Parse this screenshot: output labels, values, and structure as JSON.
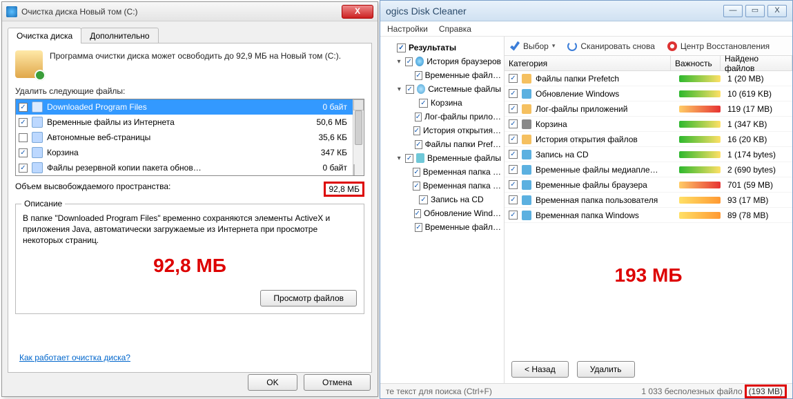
{
  "left": {
    "title": "Очистка диска Новый том (C:)",
    "close": "X",
    "tabs": {
      "active": "Очистка диска",
      "other": "Дополнительно"
    },
    "intro": "Программа очистки диска может освободить до 92,9 МБ на Новый том (C:).",
    "delete_label": "Удалить следующие файлы:",
    "items": [
      {
        "checked": true,
        "name": "Downloaded Program Files",
        "size": "0 байт",
        "sel": true
      },
      {
        "checked": true,
        "name": "Временные файлы из Интернета",
        "size": "50,6 МБ"
      },
      {
        "checked": false,
        "name": "Автономные веб-страницы",
        "size": "35,6 КБ"
      },
      {
        "checked": true,
        "name": "Корзина",
        "size": "347 КБ"
      },
      {
        "checked": true,
        "name": "Файлы резервной копии пакета обнов…",
        "size": "0 байт"
      }
    ],
    "total_label": "Объем высвобождаемого пространства:",
    "total_value": "92,8 МБ",
    "desc_title": "Описание",
    "desc_text": "В папке \"Downloaded Program Files\" временно сохраняются элементы ActiveX и приложения Java, автоматически загружаемые из Интернета при просмотре некоторых страниц.",
    "big_red": "92,8 МБ",
    "view_files": "Просмотр файлов",
    "link": "Как работает очистка диска?",
    "ok": "OK",
    "cancel": "Отмена"
  },
  "right": {
    "title": "ogics Disk Cleaner",
    "min": "—",
    "max": "▭",
    "close": "X",
    "menus": [
      "Настройки",
      "Справка"
    ],
    "tree": [
      {
        "lvl": 0,
        "exp": "",
        "chk": true,
        "bold": true,
        "ico": "",
        "label": "Результаты"
      },
      {
        "lvl": 1,
        "exp": "▾",
        "chk": true,
        "ico": "globe",
        "label": "История браузеров"
      },
      {
        "lvl": 2,
        "exp": "",
        "chk": true,
        "ico": "",
        "label": "Временные файл…"
      },
      {
        "lvl": 1,
        "exp": "▾",
        "chk": true,
        "ico": "sys",
        "label": "Системные файлы"
      },
      {
        "lvl": 2,
        "exp": "",
        "chk": true,
        "ico": "",
        "label": "Корзина"
      },
      {
        "lvl": 2,
        "exp": "",
        "chk": true,
        "ico": "",
        "label": "Лог-файлы прило…"
      },
      {
        "lvl": 2,
        "exp": "",
        "chk": true,
        "ico": "",
        "label": "История открытия…"
      },
      {
        "lvl": 2,
        "exp": "",
        "chk": true,
        "ico": "",
        "label": "Файлы папки Pref…"
      },
      {
        "lvl": 1,
        "exp": "▾",
        "chk": true,
        "ico": "file",
        "label": "Временные файлы"
      },
      {
        "lvl": 2,
        "exp": "",
        "chk": true,
        "ico": "",
        "label": "Временная папка …"
      },
      {
        "lvl": 2,
        "exp": "",
        "chk": true,
        "ico": "",
        "label": "Временная папка …"
      },
      {
        "lvl": 2,
        "exp": "",
        "chk": true,
        "ico": "",
        "label": "Запись на CD"
      },
      {
        "lvl": 2,
        "exp": "",
        "chk": true,
        "ico": "",
        "label": "Обновление Wind…"
      },
      {
        "lvl": 2,
        "exp": "",
        "chk": true,
        "ico": "",
        "label": "Временные файл…"
      }
    ],
    "toolbar": {
      "select": "Выбор",
      "scan": "Сканировать снова",
      "restore": "Центр Восстановления"
    },
    "cols": {
      "cat": "Категория",
      "imp": "Важность",
      "cnt": "Найдено файлов"
    },
    "rows": [
      {
        "chk": true,
        "name": "Файлы папки Prefetch",
        "sev": "g",
        "cnt": "1 (20 MB)"
      },
      {
        "chk": true,
        "name": "Обновление Windows",
        "sev": "g",
        "cnt": "10 (619 KB)"
      },
      {
        "chk": true,
        "name": "Лог-файлы приложений",
        "sev": "r",
        "cnt": "119 (17 MB)"
      },
      {
        "chk": true,
        "name": "Корзина",
        "sev": "g",
        "cnt": "1 (347 KB)"
      },
      {
        "chk": true,
        "name": "История открытия файлов",
        "sev": "g",
        "cnt": "16 (20 KB)"
      },
      {
        "chk": true,
        "name": "Запись на CD",
        "sev": "g",
        "cnt": "1 (174 bytes)"
      },
      {
        "chk": true,
        "name": "Временные файлы медиапле…",
        "sev": "g",
        "cnt": "2 (690 bytes)"
      },
      {
        "chk": true,
        "name": "Временные файлы браузера",
        "sev": "r",
        "cnt": "701 (59 MB)"
      },
      {
        "chk": true,
        "name": "Временная папка пользователя",
        "sev": "y",
        "cnt": "93 (17 MB)"
      },
      {
        "chk": true,
        "name": "Временная папка Windows",
        "sev": "y",
        "cnt": "89 (78 MB)"
      }
    ],
    "big_red": "193 МБ",
    "back": "< Назад",
    "delete": "Удалить",
    "status_hint": "те текст для поиска (Ctrl+F)",
    "status_summary": "1 033 бесполезных файло",
    "status_total": "(193 MB)"
  }
}
